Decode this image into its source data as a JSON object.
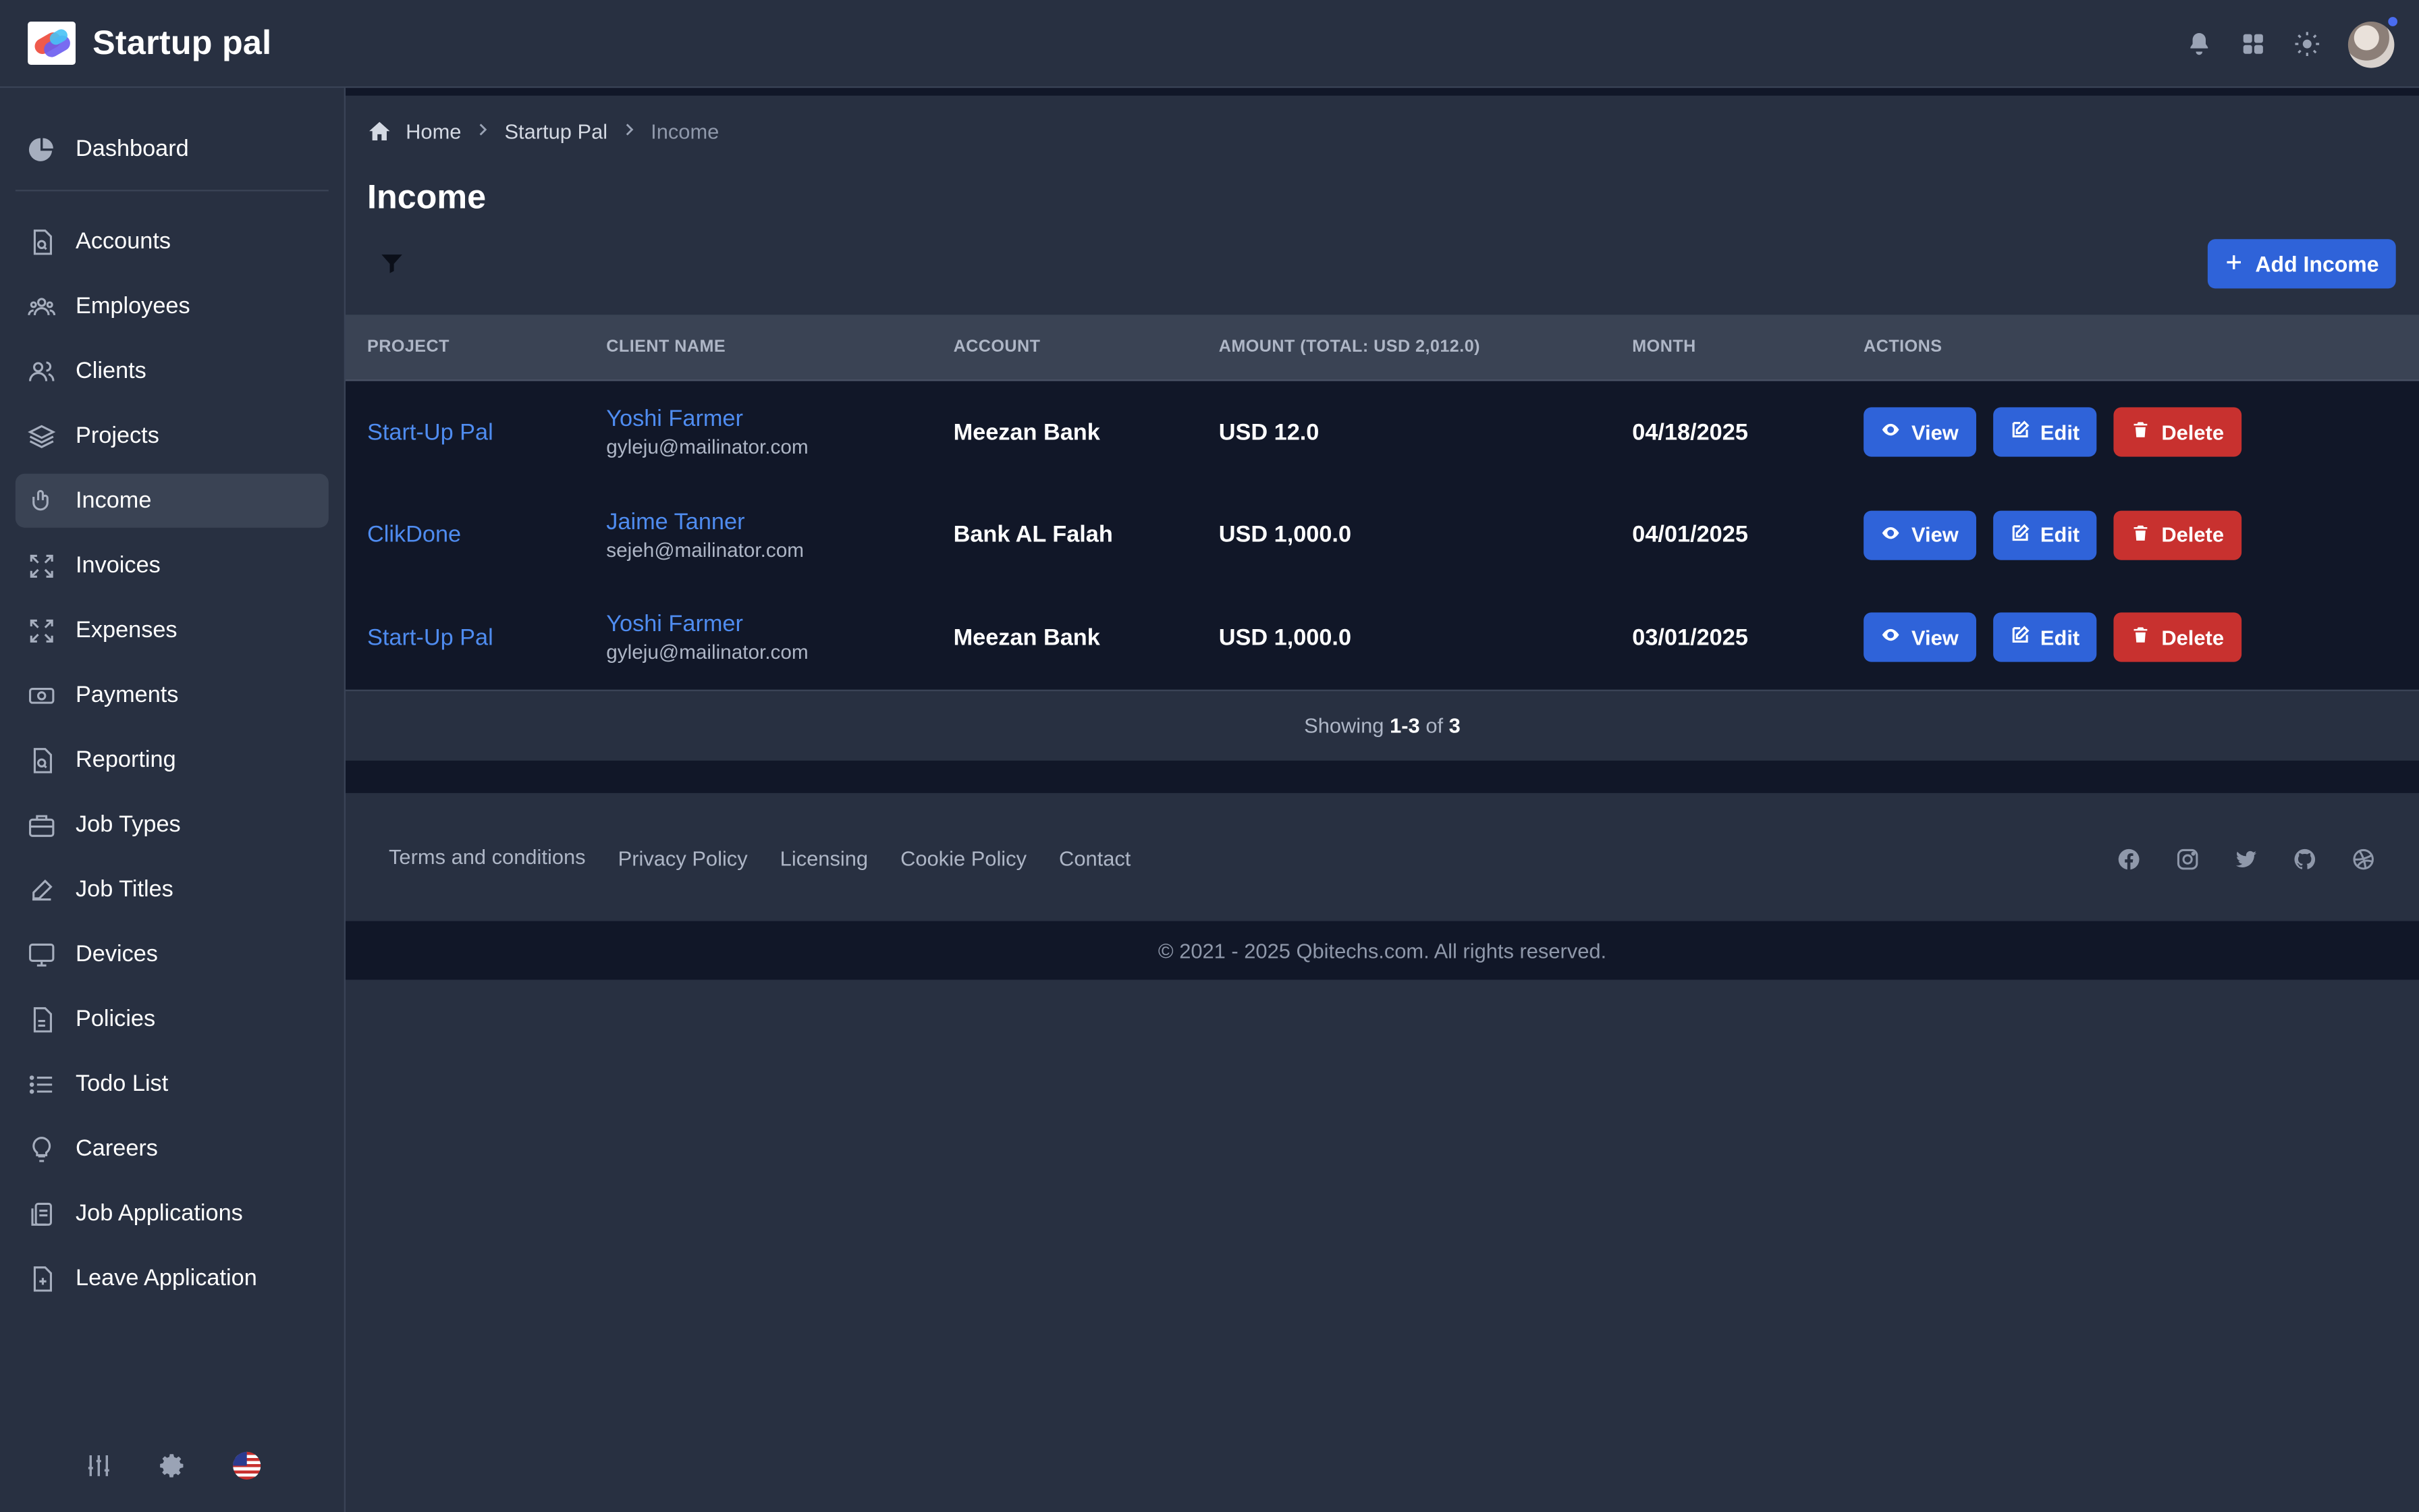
{
  "app": {
    "name": "Startup pal"
  },
  "header": {
    "icons": [
      "bell-icon",
      "apps-grid-icon",
      "sun-icon",
      "avatar"
    ]
  },
  "sidebar": {
    "items": [
      {
        "label": "Dashboard",
        "icon": "pie-chart-icon"
      },
      {
        "label": "Accounts",
        "icon": "document-search-icon"
      },
      {
        "label": "Employees",
        "icon": "users-icon"
      },
      {
        "label": "Clients",
        "icon": "user-group-icon"
      },
      {
        "label": "Projects",
        "icon": "layers-icon"
      },
      {
        "label": "Income",
        "icon": "hand-coin-icon",
        "active": true
      },
      {
        "label": "Invoices",
        "icon": "expand-icon"
      },
      {
        "label": "Expenses",
        "icon": "expand-icon"
      },
      {
        "label": "Payments",
        "icon": "cash-icon"
      },
      {
        "label": "Reporting",
        "icon": "document-search-icon"
      },
      {
        "label": "Job Types",
        "icon": "briefcase-icon"
      },
      {
        "label": "Job Titles",
        "icon": "pencil-square-icon"
      },
      {
        "label": "Devices",
        "icon": "desktop-icon"
      },
      {
        "label": "Policies",
        "icon": "document-icon"
      },
      {
        "label": "Todo List",
        "icon": "list-icon"
      },
      {
        "label": "Careers",
        "icon": "lightbulb-icon"
      },
      {
        "label": "Job Applications",
        "icon": "clipboard-icon"
      },
      {
        "label": "Leave Application",
        "icon": "document-plus-icon"
      }
    ],
    "bottom_icons": [
      "sliders-icon",
      "gear-icon",
      "us-flag-icon"
    ]
  },
  "breadcrumb": {
    "home": "Home",
    "parent": "Startup Pal",
    "current": "Income"
  },
  "page": {
    "title": "Income",
    "add_button": "Add Income"
  },
  "table": {
    "headers": {
      "project": "PROJECT",
      "client": "CLIENT NAME",
      "account": "ACCOUNT",
      "amount": "AMOUNT",
      "amount_total": "(TOTAL: USD 2,012.0)",
      "month": "MONTH",
      "actions": "ACTIONS"
    },
    "rows": [
      {
        "project": "Start-Up Pal",
        "client_name": "Yoshi Farmer",
        "client_email": "gyleju@mailinator.com",
        "account": "Meezan Bank",
        "amount": "USD 12.0",
        "month": "04/18/2025"
      },
      {
        "project": "ClikDone",
        "client_name": "Jaime Tanner",
        "client_email": "sejeh@mailinator.com",
        "account": "Bank AL Falah",
        "amount": "USD 1,000.0",
        "month": "04/01/2025"
      },
      {
        "project": "Start-Up Pal",
        "client_name": "Yoshi Farmer",
        "client_email": "gyleju@mailinator.com",
        "account": "Meezan Bank",
        "amount": "USD 1,000.0",
        "month": "03/01/2025"
      }
    ],
    "actions": {
      "view": "View",
      "edit": "Edit",
      "delete": "Delete"
    }
  },
  "pagination": {
    "prefix": "Showing",
    "range": "1-3",
    "of": "of",
    "total": "3"
  },
  "footer": {
    "links": [
      "Terms and conditions",
      "Privacy Policy",
      "Licensing",
      "Cookie Policy",
      "Contact"
    ],
    "social": [
      "facebook-icon",
      "instagram-icon",
      "twitter-icon",
      "github-icon",
      "dribbble-icon"
    ],
    "copyright": "© 2021 - 2025 Qbitechs.com. All rights reserved."
  },
  "colors": {
    "background": "#283041",
    "table_body": "#111728",
    "primary": "#2f63d9",
    "danger": "#c8312f",
    "link": "#4f8cf0"
  }
}
